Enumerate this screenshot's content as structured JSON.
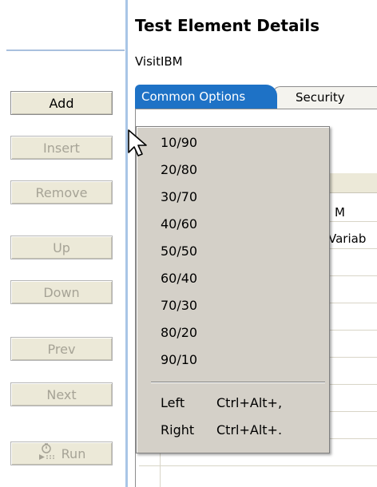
{
  "left_panel": {
    "buttons": [
      {
        "label": "Add",
        "enabled": true
      },
      {
        "label": "Insert",
        "enabled": false
      },
      {
        "label": "Remove",
        "enabled": false
      },
      {
        "label": "Up",
        "enabled": false
      },
      {
        "label": "Down",
        "enabled": false
      },
      {
        "label": "Prev",
        "enabled": false
      },
      {
        "label": "Next",
        "enabled": false
      },
      {
        "label": "Run",
        "enabled": false,
        "icon": "run-icon"
      }
    ]
  },
  "details": {
    "title": "Test Element Details",
    "element_name": "VisitIBM",
    "tabs": [
      {
        "label": "Common Options",
        "active": true
      },
      {
        "label": "Security",
        "active": false
      }
    ],
    "grid": {
      "cell_top": "M",
      "cell_second": "Variab"
    }
  },
  "context_menu": {
    "ratio_items": [
      "10/90",
      "20/80",
      "30/70",
      "40/60",
      "50/50",
      "60/40",
      "70/30",
      "80/20",
      "90/10"
    ],
    "command_items": [
      {
        "label": "Left",
        "shortcut": "Ctrl+Alt+,"
      },
      {
        "label": "Right",
        "shortcut": "Ctrl+Alt+."
      }
    ]
  },
  "colors": {
    "active_tab": "#1e72c6",
    "splitter": "#a9c5e6",
    "menu_background": "#d4d0c8",
    "disabled_text": "#a6a396"
  },
  "icons": [
    "run-icon",
    "mouse-cursor-icon"
  ]
}
